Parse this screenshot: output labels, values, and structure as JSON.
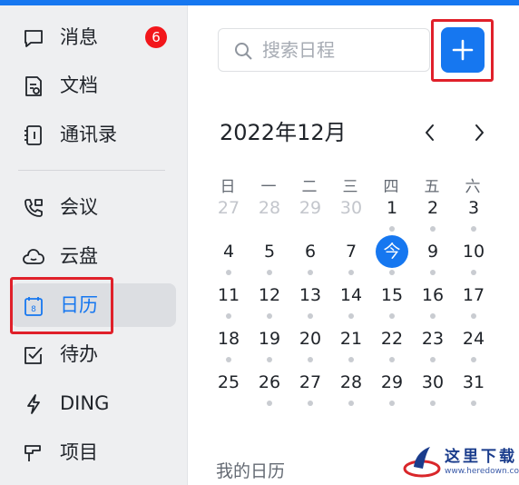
{
  "sidebar": {
    "items": [
      {
        "name": "messages",
        "label": "消息",
        "icon": "message-icon",
        "badge": "6"
      },
      {
        "name": "docs",
        "label": "文档",
        "icon": "document-icon"
      },
      {
        "name": "contacts",
        "label": "通讯录",
        "icon": "contacts-icon"
      },
      {
        "name": "meetings",
        "label": "会议",
        "icon": "video-call-icon"
      },
      {
        "name": "cloud-drive",
        "label": "云盘",
        "icon": "cloud-icon"
      },
      {
        "name": "calendar",
        "label": "日历",
        "icon": "calendar-icon",
        "active": true,
        "icon_day": "8"
      },
      {
        "name": "todo",
        "label": "待办",
        "icon": "checkbox-icon"
      },
      {
        "name": "ding",
        "label": "DING",
        "icon": "lightning-icon"
      },
      {
        "name": "projects",
        "label": "项目",
        "icon": "project-icon"
      }
    ]
  },
  "search": {
    "placeholder": "搜索日程"
  },
  "calendar": {
    "title": "2022年12月",
    "weekdays": [
      "日",
      "一",
      "二",
      "三",
      "四",
      "五",
      "六"
    ],
    "today_label": "今",
    "weeks": [
      [
        "27",
        "28",
        "29",
        "30",
        "1",
        "2",
        "3"
      ],
      [
        "4",
        "5",
        "6",
        "7",
        "今",
        "9",
        "10"
      ],
      [
        "11",
        "12",
        "13",
        "14",
        "15",
        "16",
        "17"
      ],
      [
        "18",
        "19",
        "20",
        "21",
        "22",
        "23",
        "24"
      ],
      [
        "25",
        "26",
        "27",
        "28",
        "29",
        "30",
        "31"
      ]
    ],
    "other_month_days": [
      "27",
      "28",
      "29",
      "30"
    ]
  },
  "my_calendars": {
    "title": "我的日历"
  },
  "watermark": {
    "text": "这里下载",
    "url": "www.heredown.com"
  },
  "colors": {
    "accent": "#1677f0",
    "badge": "#f2161b",
    "highlight": "#e0202a",
    "sidebar_bg": "#eeeff1"
  }
}
